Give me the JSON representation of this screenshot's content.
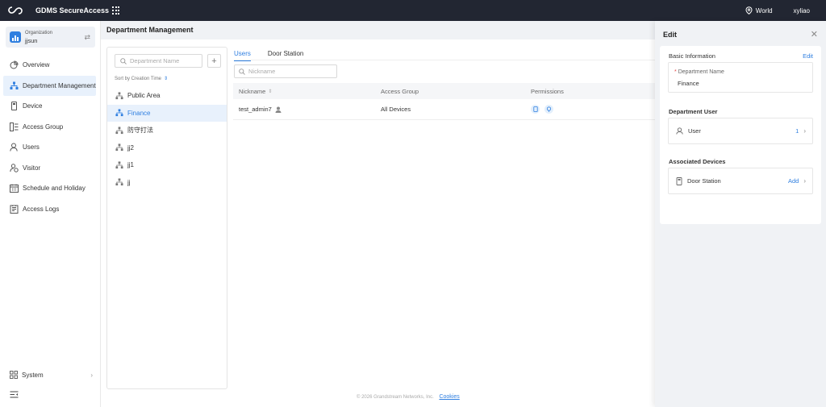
{
  "header": {
    "app_title": "GDMS SecureAccess",
    "region": "World",
    "user": "xyliao"
  },
  "sidebar": {
    "org_label": "Organization",
    "org_name": "jjsun",
    "items": [
      {
        "label": "Overview",
        "icon": "overview-icon"
      },
      {
        "label": "Department Management",
        "icon": "department-icon",
        "active": true
      },
      {
        "label": "Device",
        "icon": "device-icon"
      },
      {
        "label": "Access Group",
        "icon": "access-group-icon"
      },
      {
        "label": "Users",
        "icon": "users-icon"
      },
      {
        "label": "Visitor",
        "icon": "visitor-icon"
      },
      {
        "label": "Schedule and Holiday",
        "icon": "calendar-icon"
      },
      {
        "label": "Access Logs",
        "icon": "logs-icon"
      }
    ],
    "system_label": "System"
  },
  "main": {
    "title": "Department Management",
    "dept_search_placeholder": "Department Name",
    "sort_label": "Sort by Creation Time",
    "departments": [
      {
        "name": "Public Area"
      },
      {
        "name": "Finance",
        "active": true
      },
      {
        "name": "防守打法"
      },
      {
        "name": "jj2"
      },
      {
        "name": "jj1"
      },
      {
        "name": "jj"
      }
    ],
    "tabs": [
      {
        "label": "Users",
        "active": true
      },
      {
        "label": "Door Station"
      }
    ],
    "nickname_placeholder": "Nickname",
    "columns": [
      "Nickname",
      "Access Group",
      "Permissions"
    ],
    "rows": [
      {
        "nickname": "test_admin7",
        "access_group": "All Devices"
      }
    ],
    "footer": "© 2026 Grandstream Networks, Inc.",
    "cookies": "Cookies"
  },
  "drawer": {
    "title": "Edit",
    "basic_info": "Basic Information",
    "edit_label": "Edit",
    "dept_name_label": "Department Name",
    "dept_name_value": "Finance",
    "dept_user_title": "Department User",
    "user_label": "User",
    "user_count": "1",
    "assoc_title": "Associated Devices",
    "door_station_label": "Door Station",
    "add_label": "Add"
  },
  "colors": {
    "accent": "#2f7fe0",
    "topbar": "#222632",
    "active_bg": "#e8f1fc"
  }
}
